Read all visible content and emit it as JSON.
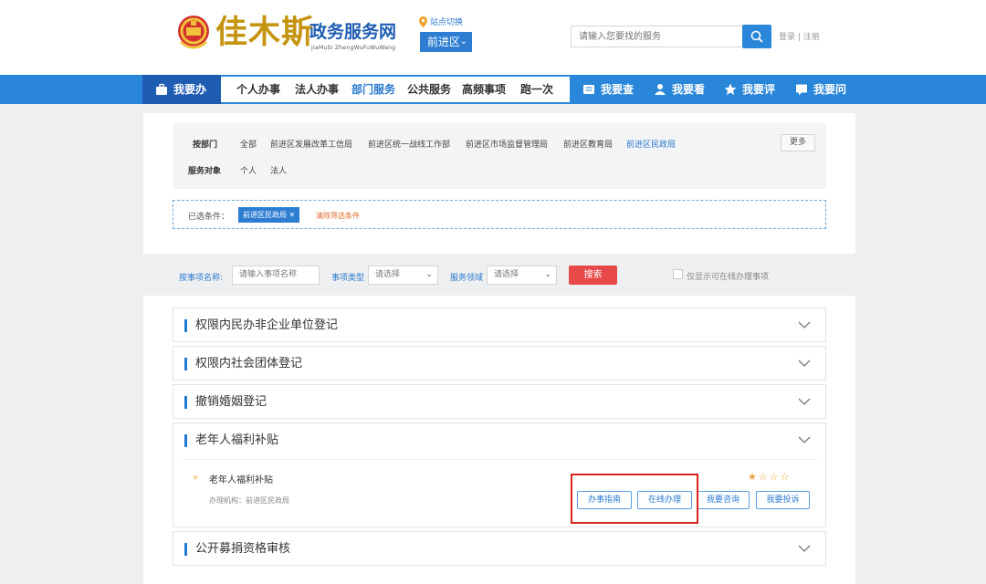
{
  "header": {
    "logo_text": "佳木斯",
    "site_title": "政务服务网",
    "site_pinyin": "JiaMuSi ZhengWuFuWuWang",
    "location_switch": "站点切换",
    "district": "前进区",
    "search_placeholder": "请输入您要找的服务",
    "login": "登录",
    "register": "注册"
  },
  "nav": {
    "primary": "我要办",
    "items": [
      "个人办事",
      "法人办事",
      "部门服务",
      "公共服务",
      "高频事项",
      "跑一次"
    ],
    "active_index": 2,
    "right": [
      "我要查",
      "我要看",
      "我要评",
      "我要问"
    ]
  },
  "filters": {
    "dept_label": "按部门",
    "dept_options": [
      "全部",
      "前进区发展改革工信局",
      "前进区统一战线工作部",
      "前进区市场监督管理局",
      "前进区教育局",
      "前进区民政局"
    ],
    "dept_selected_index": 5,
    "more": "更多",
    "target_label": "服务对象",
    "target_options": [
      "个人",
      "法人"
    ],
    "selected_label": "已选条件：",
    "selected_tag": "前进区民政局",
    "clear_label": "清除筛选条件"
  },
  "search_bar": {
    "name_label": "按事项名称:",
    "name_placeholder": "请输入事项名称",
    "type_label": "事项类型",
    "type_value": "请选择",
    "domain_label": "服务领域",
    "domain_value": "请选择",
    "submit": "搜索",
    "online_only": "仅显示可在线办理事项"
  },
  "list": {
    "items": [
      "权限内民办非企业单位登记",
      "权限内社会团体登记",
      "撤销婚姻登记",
      "老年人福利补贴",
      "公开募捐资格审核"
    ],
    "expanded": {
      "name": "老年人福利补贴",
      "org": "办理机构：前进区民政局",
      "rating": 1,
      "rating_max": 4,
      "buttons": [
        "办事指南",
        "在线办理",
        "我要咨询",
        "我要投诉"
      ]
    }
  },
  "colors": {
    "brand_blue": "#2a86d8",
    "dark_blue": "#1f5db3",
    "gold": "#c59411",
    "highlight_red": "#d9251c"
  }
}
